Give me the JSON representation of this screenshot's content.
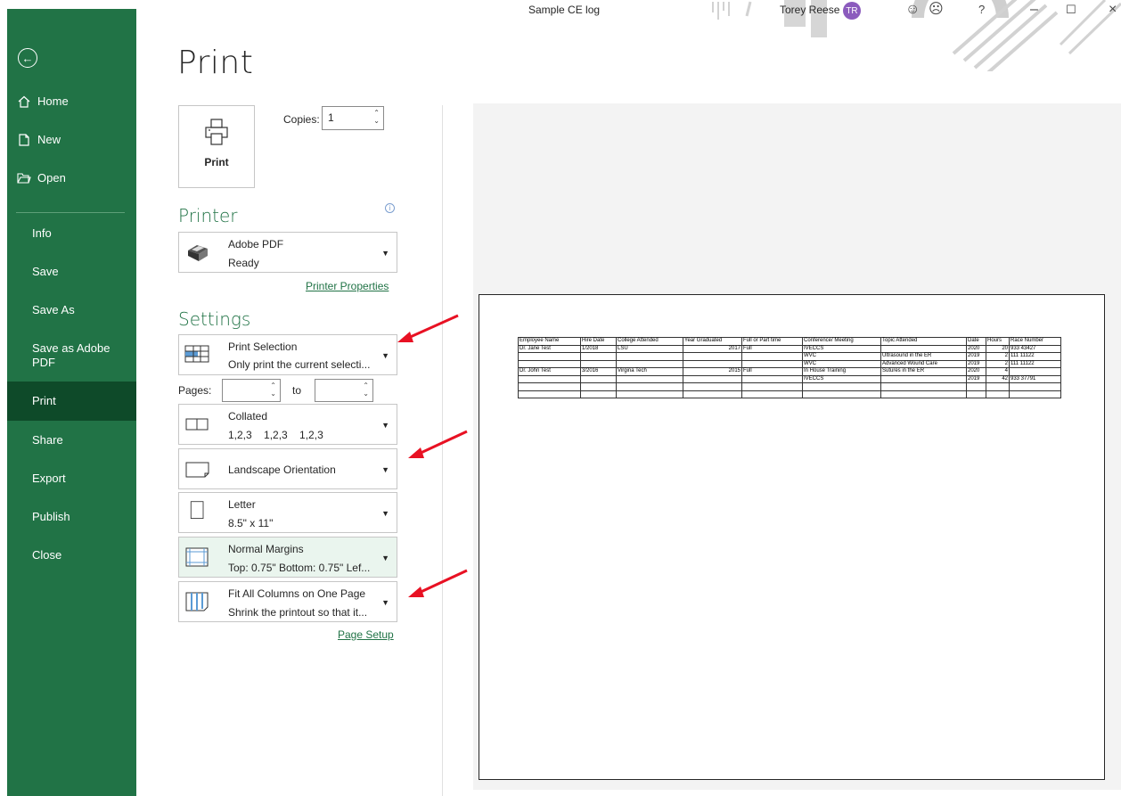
{
  "window": {
    "doc_title": "Sample CE log",
    "user_name": "Torey Reese",
    "user_initials": "TR"
  },
  "nav": {
    "back_icon": "back-arrow-icon",
    "items": [
      {
        "label": "Home",
        "icon": "home-icon"
      },
      {
        "label": "New",
        "icon": "new-document-icon"
      },
      {
        "label": "Open",
        "icon": "open-folder-icon"
      },
      {
        "label": "Info"
      },
      {
        "label": "Save"
      },
      {
        "label": "Save As"
      },
      {
        "label": "Save as Adobe PDF"
      },
      {
        "label": "Print",
        "active": true
      },
      {
        "label": "Share"
      },
      {
        "label": "Export"
      },
      {
        "label": "Publish"
      },
      {
        "label": "Close"
      }
    ]
  },
  "print": {
    "title": "Print",
    "button_label": "Print",
    "copies_label": "Copies:",
    "copies_value": "1"
  },
  "printer": {
    "heading": "Printer",
    "name": "Adobe PDF",
    "status": "Ready",
    "properties_link": "Printer Properties"
  },
  "settings": {
    "heading": "Settings",
    "selection": {
      "line1": "Print Selection",
      "line2": "Only print the current selecti..."
    },
    "pages_label": "Pages:",
    "to_label": "to",
    "collation": {
      "line1": "Collated",
      "line2": "1,2,3    1,2,3    1,2,3"
    },
    "orientation": {
      "line1": "Landscape Orientation"
    },
    "paper": {
      "line1": "Letter",
      "line2": "8.5\" x 11\""
    },
    "margins": {
      "line1": "Normal Margins",
      "line2": "Top: 0.75\" Bottom: 0.75\" Lef..."
    },
    "scaling": {
      "line1": "Fit All Columns on One Page",
      "line2": "Shrink the printout so that it..."
    },
    "page_setup_link": "Page Setup"
  },
  "preview": {
    "headers": [
      "Employee Name",
      "Hire Date",
      "College Attended",
      "Year Graduated",
      "Full or Part time",
      "Conference/ Meeting",
      "Topic Attended",
      "Date",
      "Hours",
      "Race Number"
    ],
    "rows": [
      [
        "Dr. Jane Test",
        "1/2018",
        "LSU",
        "2017",
        "Full",
        "IVECCS",
        "",
        "2020",
        "20",
        "933 43427"
      ],
      [
        "",
        "",
        "",
        "",
        "",
        "WVC",
        "Ultrasound in the ER",
        "2019",
        "2",
        "111 11122"
      ],
      [
        "",
        "",
        "",
        "",
        "",
        "WVC",
        "Advanced Wound Care",
        "2019",
        "2",
        "111 11122"
      ],
      [
        "Dr. John Test",
        "3/2016",
        "Virgina Tech",
        "2015",
        "Full",
        "In House Training",
        "Sutures in the ER",
        "2020",
        "4",
        ""
      ],
      [
        "",
        "",
        "",
        "",
        "",
        "IVECCS",
        "",
        "2019",
        "42",
        "933 37791"
      ],
      [
        "",
        "",
        "",
        "",
        "",
        "",
        "",
        "",
        "",
        ""
      ],
      [
        "",
        "",
        "",
        "",
        "",
        "",
        "",
        "",
        "",
        ""
      ]
    ]
  },
  "colors": {
    "nav_bg": "#217346",
    "nav_active": "#0e4a29",
    "accent": "#217346",
    "arrow": "#e81123",
    "avatar": "#8b5bbd"
  }
}
